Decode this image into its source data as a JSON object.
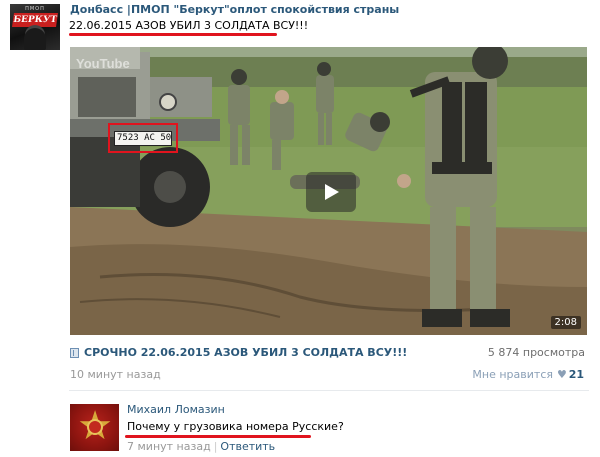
{
  "post": {
    "author": "Донбасс |ПМОП \"Беркут\"оплот спокойствия страны",
    "avatar_caption": "ПМОП",
    "avatar_logo": "БЕРКУТ",
    "text": "22.06.2015 АЗОВ УБИЛ 3 СОЛДАТА ВСУ!!!",
    "time": "10 минут назад"
  },
  "video": {
    "watermark": "YouTube",
    "plate_number": "7523 АС 50",
    "duration": "2:08",
    "title": "СРОЧНО 22.06.2015 АЗОВ УБИЛ 3 СОЛДАТА ВСУ!!!",
    "views": "5 874 просмотра",
    "icons": {
      "video_type": "film-icon",
      "play": "play-icon"
    }
  },
  "likes": {
    "label": "Мне нравится",
    "icon": "heart-icon",
    "count": "21"
  },
  "comment": {
    "author": "Михаил Ломазин",
    "text": "Почему у грузовика номера Русские?",
    "time": "7 минут назад",
    "separator": "|",
    "reply_label": "Ответить"
  },
  "colors": {
    "link": "#2b587a",
    "meta": "#999999",
    "highlight": "#e0141e"
  }
}
